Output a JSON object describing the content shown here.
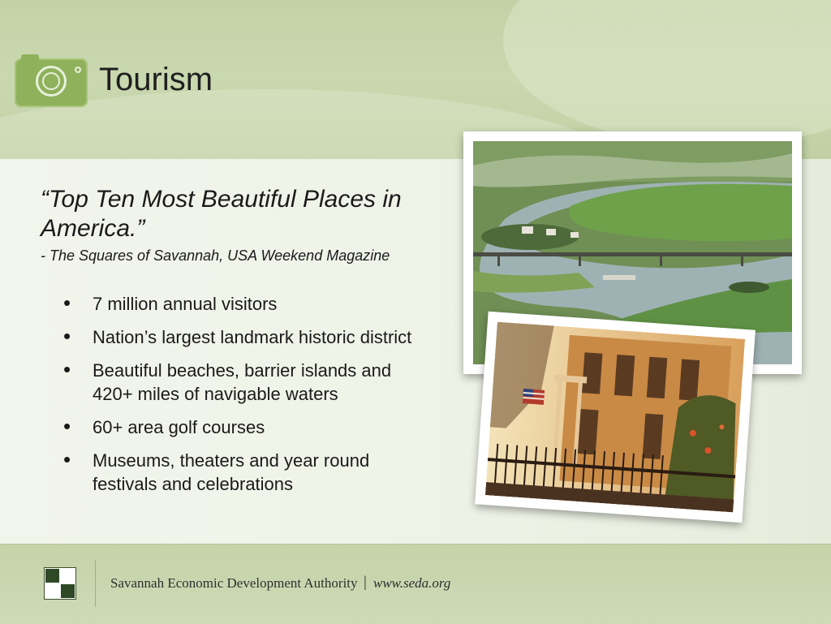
{
  "header": {
    "title": "Tourism",
    "icon": "camera-icon"
  },
  "quote": {
    "text": "“Top Ten Most Beautiful Places in America.”",
    "attribution": "- The Squares of Savannah, USA Weekend Magazine"
  },
  "bullets": [
    "7 million annual visitors",
    "Nation’s largest landmark historic district",
    "Beautiful beaches, barrier islands and 420+ miles of navigable waters",
    "60+ area golf courses",
    "Museums, theaters and year round festivals and celebrations"
  ],
  "bullet_glyph": "•",
  "photos": [
    {
      "subject": "aerial-marsh-river-bridge-photo"
    },
    {
      "subject": "historic-house-flag-iron-fence-photo"
    }
  ],
  "footer": {
    "organization": "Savannah Economic Development Authority",
    "separator": "|",
    "url": "www.seda.org"
  },
  "colors": {
    "accent_green": "#8fb15b",
    "header_band": "#c9d6b2",
    "content_band": "#f2f5ec",
    "text": "#1a1a1a"
  }
}
